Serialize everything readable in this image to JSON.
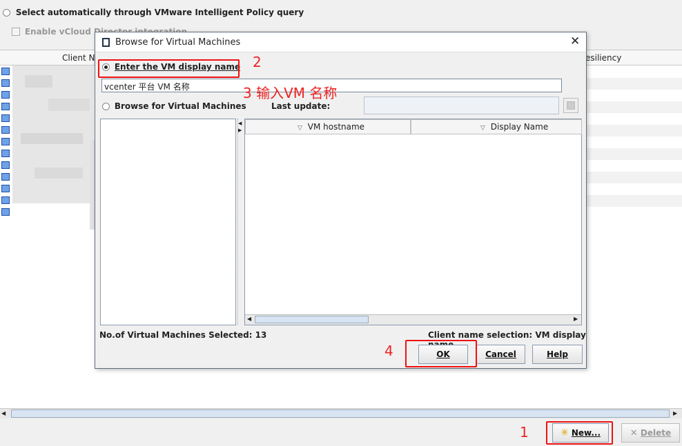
{
  "background": {
    "option_vip_label": "Select automatically through VMware Intelligent Policy query",
    "vcloud_label": "Enable vCloud Director integration",
    "col_client_name": "Client Na",
    "col_resiliency": "esiliency",
    "new_button": "New...",
    "delete_button": "Delete"
  },
  "dialog": {
    "title": "Browse for Virtual Machines",
    "radio_enter_name": "Enter the VM display name",
    "vm_name_value": "vcenter 平台 VM 名称",
    "radio_browse": "Browse for Virtual Machines",
    "last_update_label": "Last update:",
    "col_vm_hostname": "VM hostname",
    "col_display_name": "Display Name",
    "vm_selected_count": "No.of Virtual Machines Selected: 13",
    "client_name_selection": "Client name selection: VM display name",
    "ok_button": "OK",
    "cancel_button": "Cancel",
    "help_button": "Help"
  },
  "annotations": {
    "step1": "1",
    "step2": "2",
    "step3": "3  输入VM 名称",
    "step4": "4",
    "color": "#e11111"
  }
}
